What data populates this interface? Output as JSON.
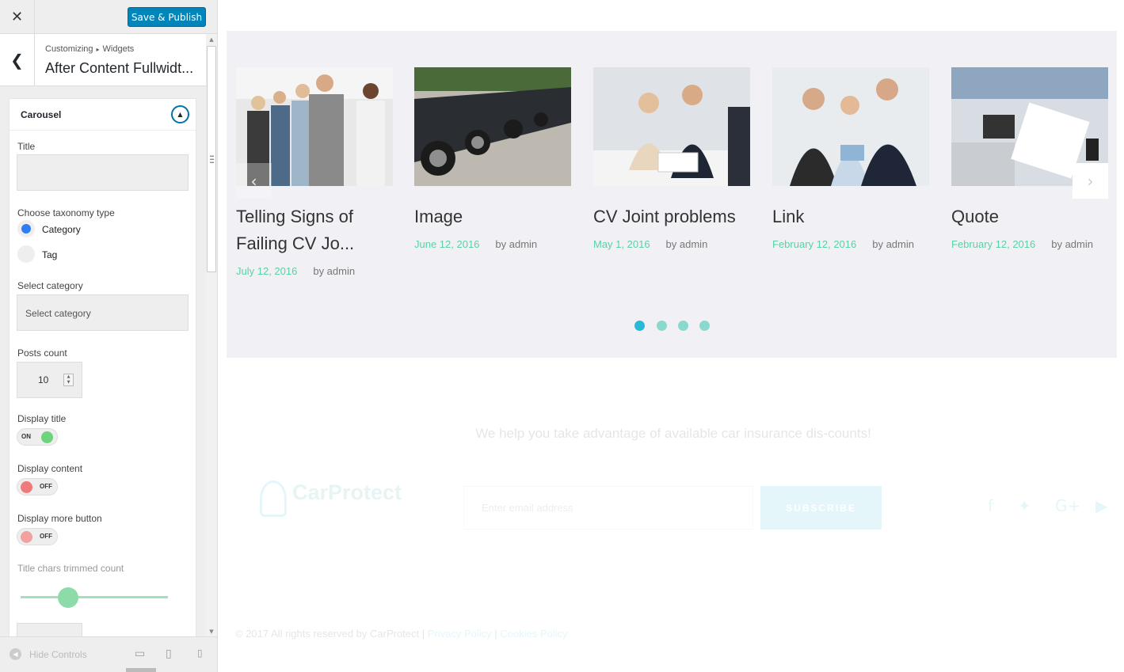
{
  "topbar": {
    "close_icon": "close-icon",
    "publish_label": "Save & Publish"
  },
  "section": {
    "breadcrumb_1": "Customizing",
    "breadcrumb_sep": "▸",
    "breadcrumb_2": "Widgets",
    "title": "After Content Fullwidt..."
  },
  "widget": {
    "title": "Carousel",
    "fields": {
      "title_label": "Title",
      "title_value": "",
      "taxonomy_label": "Choose taxonomy type",
      "taxonomy_options": [
        "Category",
        "Tag"
      ],
      "taxonomy_selected": "Category",
      "category_label": "Select category",
      "category_value": "Select category",
      "posts_count_label": "Posts count",
      "posts_count_value": "10",
      "display_title_label": "Display title",
      "display_title_state": "ON",
      "display_content_label": "Display content",
      "display_content_state": "OFF",
      "display_more_label": "Display more button",
      "display_more_state": "OFF",
      "trim_label": "Title chars trimmed count",
      "trim_slider_fraction": 0.33
    }
  },
  "footer": {
    "hide_label": "Hide Controls",
    "devices": [
      "desktop-icon",
      "tablet-icon",
      "mobile-icon"
    ]
  },
  "carousel": {
    "posts": [
      {
        "title": "Telling Signs of Failing CV Jo...",
        "date": "July 12, 2016",
        "author": "by admin"
      },
      {
        "title": "Image",
        "date": "June 12, 2016",
        "author": "by admin"
      },
      {
        "title": "CV Joint problems",
        "date": "May 1, 2016",
        "author": "by admin"
      },
      {
        "title": "Link",
        "date": "February 12, 2016",
        "author": "by admin"
      },
      {
        "title": "Quote",
        "date": "February 12, 2016",
        "author": "by admin"
      }
    ],
    "pages": 4,
    "active_page": 1,
    "accent": "#5cd1a4",
    "dot_active": "#29b8d6"
  },
  "site_footer": {
    "tagline": "We help you take advantage of available car insurance dis-counts!",
    "brand": "CarProtect",
    "email_placeholder": "Enter email address",
    "subscribe_label": "SUBSCRIBE",
    "social": [
      "facebook-icon",
      "twitter-icon",
      "google-plus-icon",
      "youtube-icon"
    ],
    "copyright": "© 2017 All rights reserved by CarProtect",
    "privacy": "Privacy Policy",
    "cookies": "Cookies Policy"
  }
}
